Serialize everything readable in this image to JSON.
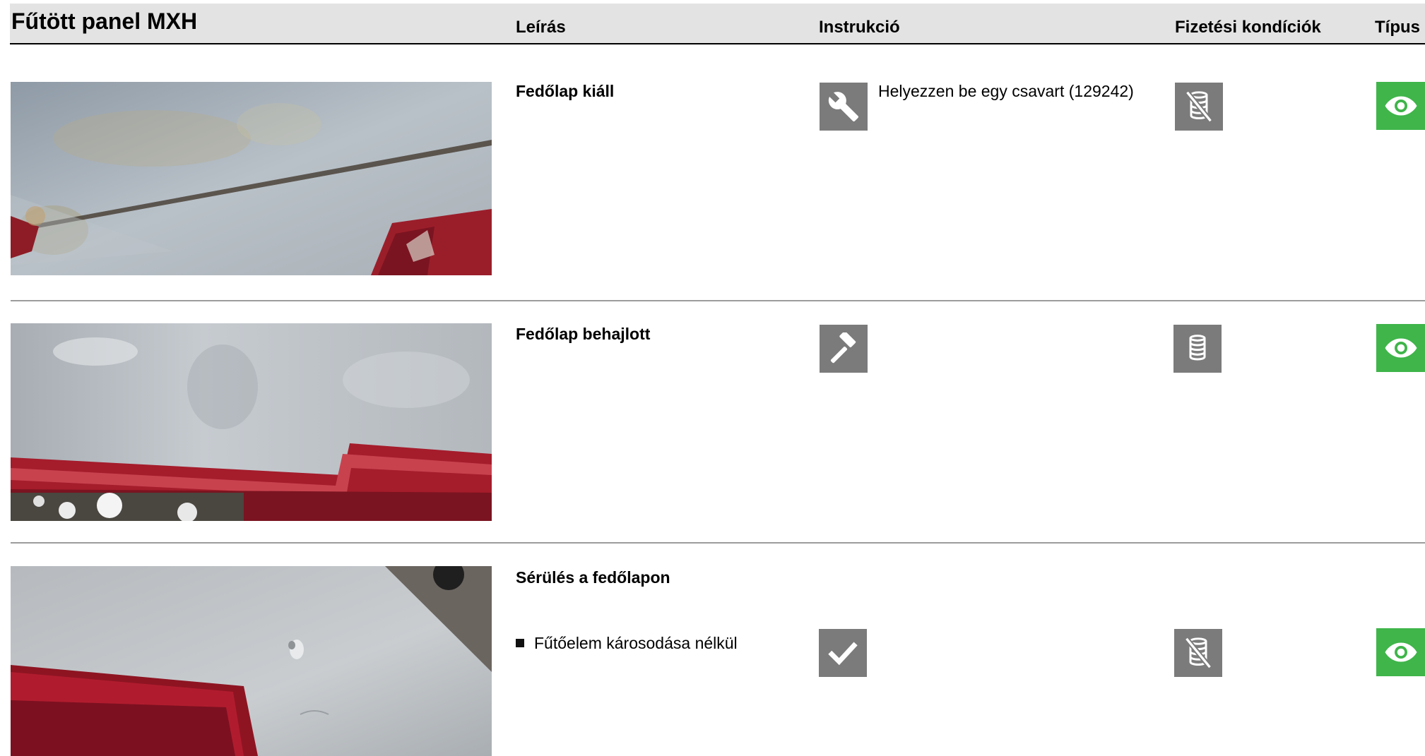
{
  "header": {
    "title": "Fűtött panel MXH",
    "columns": {
      "description": "Leírás",
      "instruction": "Instrukció",
      "payment": "Fizetési kondíciók",
      "type": "Típus"
    }
  },
  "rows": [
    {
      "title": "Fedőlap kiáll",
      "instruction_icon": "wrench-icon",
      "instruction_text": "Helyezzen be egy csavart (129242)",
      "payment_icon": "coins-crossed-icon",
      "type_icon": "eye-icon"
    },
    {
      "title": "Fedőlap behajlott",
      "instruction_icon": "hammer-icon",
      "payment_icon": "coins-icon",
      "type_icon": "eye-icon"
    },
    {
      "title": "Sérülés a fedőlapon",
      "bullet": "Fűtőelem károsodása nélkül",
      "instruction_icon": "check-icon",
      "payment_icon": "coins-crossed-icon",
      "type_icon": "eye-icon"
    }
  ],
  "colors": {
    "header_bg": "#e3e3e3",
    "icon_gray": "#7b7b7c",
    "eye_green": "#3fb54a",
    "separator": "#9c9c9c"
  }
}
